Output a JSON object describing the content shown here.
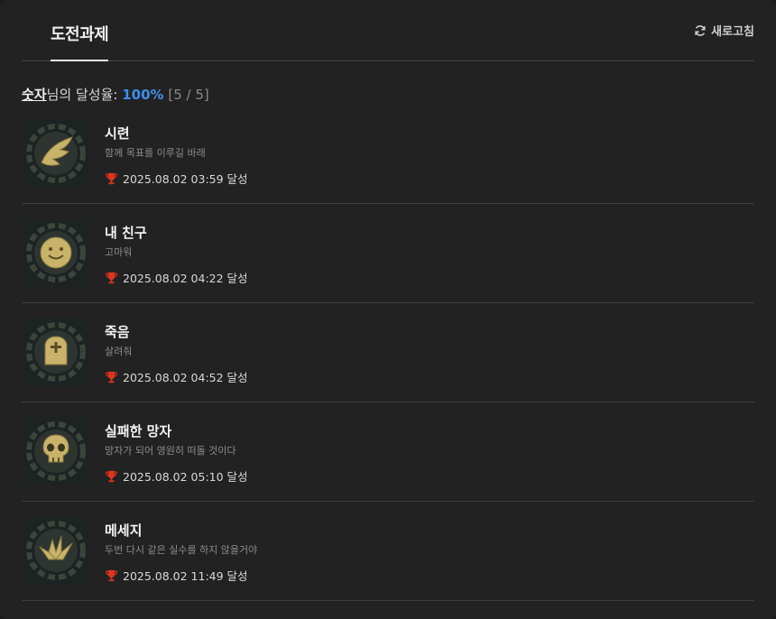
{
  "tabs": {
    "active": "도전과제"
  },
  "refresh": {
    "label": "새로고침",
    "icon": "refresh-icon"
  },
  "rate": {
    "user": "숫자",
    "suffix": "님의 달성율:",
    "percent": "100%",
    "fraction": "[5 / 5]"
  },
  "achievements": [
    {
      "title": "시련",
      "desc": "함께 목표를 이루길 바래",
      "date": "2025.08.02 03:59 달성",
      "icon": "wing-icon"
    },
    {
      "title": "내 친구",
      "desc": "고마워",
      "date": "2025.08.02 04:22 달성",
      "icon": "smiley-icon"
    },
    {
      "title": "죽음",
      "desc": "살려줘",
      "date": "2025.08.02 04:52 달성",
      "icon": "tombstone-icon"
    },
    {
      "title": "실패한 망자",
      "desc": "망자가 되어 영원히 떠돌 것이다",
      "date": "2025.08.02 05:10 달성",
      "icon": "skull-icon"
    },
    {
      "title": "메세지",
      "desc": "두번 다시 같은 실수를 하지 않을거야",
      "date": "2025.08.02 11:49 달성",
      "icon": "paper-crane-icon"
    }
  ],
  "colors": {
    "accent": "#3d8eea",
    "trophy": "#e0341e",
    "badge_gold": "#c9b26a"
  }
}
